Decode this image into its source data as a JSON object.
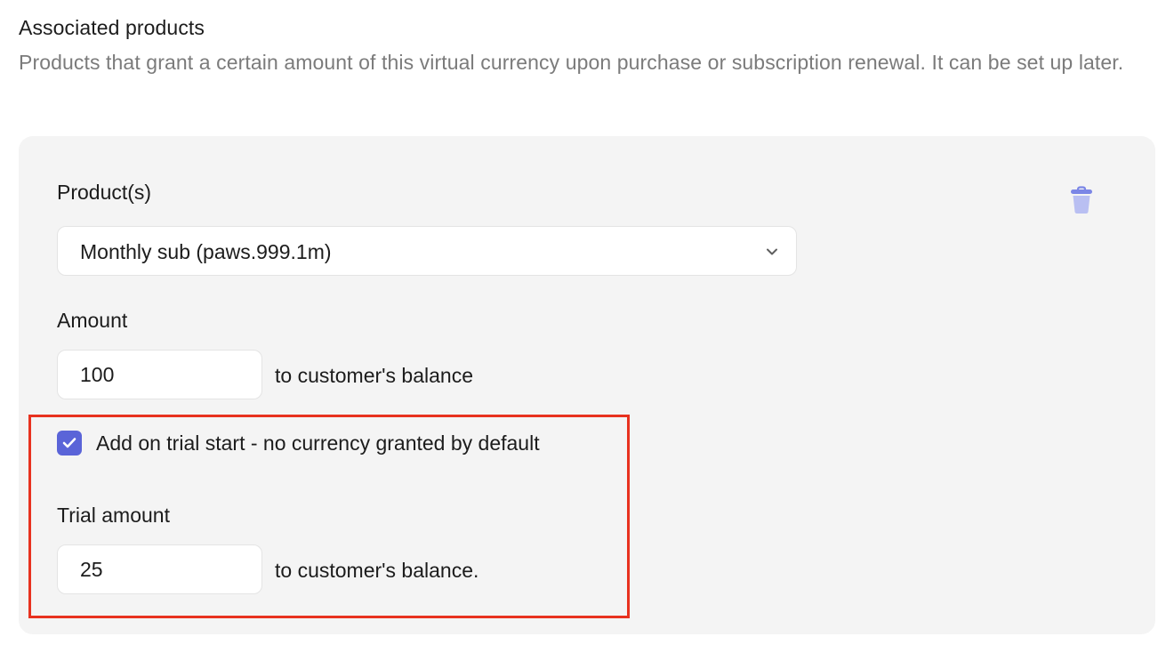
{
  "section": {
    "title": "Associated products",
    "description": "Products that grant a certain amount of this virtual currency upon purchase or subscription renewal. It can be set up later."
  },
  "product": {
    "label": "Product(s)",
    "selected": "Monthly sub (paws.999.1m)",
    "chevron_icon": "chevron-down-icon",
    "delete_icon": "trash-icon"
  },
  "amount": {
    "label": "Amount",
    "value": "100",
    "suffix": "to customer's balance"
  },
  "trial": {
    "checkbox_label": "Add on trial start - no currency granted by default",
    "checked": true,
    "amount_label": "Trial amount",
    "value": "25",
    "suffix": "to customer's balance."
  },
  "colors": {
    "accent": "#5a64d8",
    "trash": "#7b86e6",
    "highlight": "#e8321f",
    "card_bg": "#f4f4f4",
    "muted_text": "#7b7b7b"
  }
}
